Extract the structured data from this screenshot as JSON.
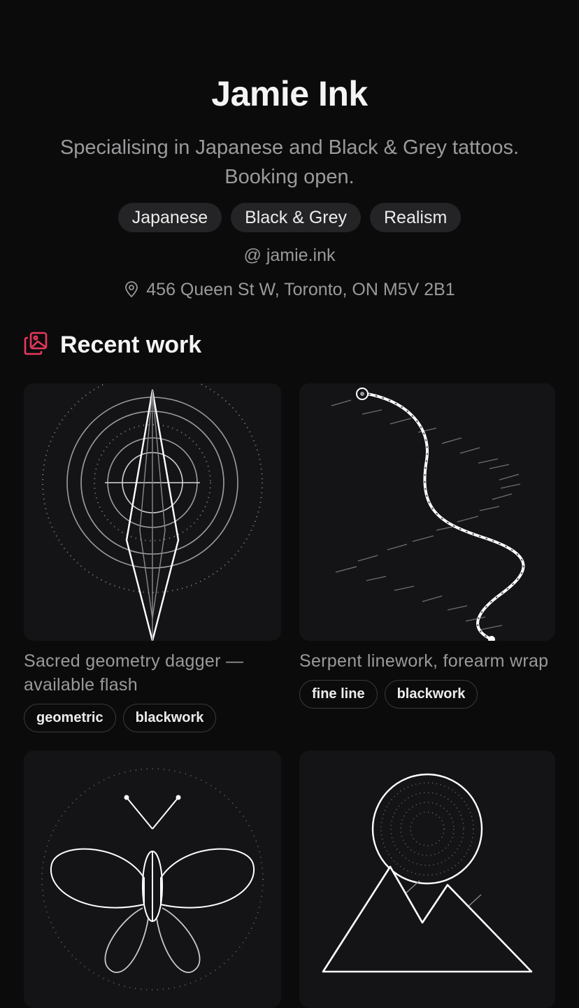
{
  "profile": {
    "name": "Jamie Ink",
    "bio": "Specialising in Japanese and Black & Grey tattoos. Booking open.",
    "styles": [
      "Japanese",
      "Black & Grey",
      "Realism"
    ],
    "handle": "@ jamie.ink",
    "address": "456 Queen St W, Toronto, ON M5V 2B1"
  },
  "icons": {
    "location": "location-pin-icon",
    "section": "gallery-icon"
  },
  "colors": {
    "accent": "#e8385c",
    "background": "#0b0b0c",
    "card": "#141416"
  },
  "section": {
    "title": "Recent work"
  },
  "works": [
    {
      "caption": "Sacred geometry dagger — available flash",
      "tags": [
        "geometric",
        "blackwork"
      ]
    },
    {
      "caption": "Serpent linework, forearm wrap",
      "tags": [
        "fine line",
        "blackwork"
      ]
    },
    {
      "caption": "",
      "tags": []
    },
    {
      "caption": "",
      "tags": []
    }
  ]
}
